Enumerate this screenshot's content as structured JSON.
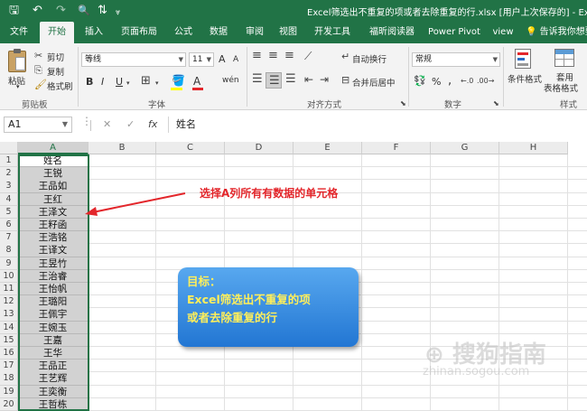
{
  "window": {
    "title": "Excel筛选出不重复的项或者去除重复的行.xlsx [用户上次保存的] - Exc"
  },
  "quick_access": {
    "save": "🖫",
    "undo": "↶",
    "redo": "↷",
    "preview": "🔍",
    "sort": "⇅",
    "more": "⩔"
  },
  "tabs": [
    {
      "label": "文件"
    },
    {
      "label": "开始"
    },
    {
      "label": "插入"
    },
    {
      "label": "页面布局"
    },
    {
      "label": "公式"
    },
    {
      "label": "数据"
    },
    {
      "label": "审阅"
    },
    {
      "label": "视图"
    },
    {
      "label": "开发工具"
    },
    {
      "label": "福昕阅读器"
    },
    {
      "label": "Power Pivot"
    },
    {
      "label": "view"
    },
    {
      "label": "告诉我你想要"
    }
  ],
  "ribbon": {
    "clipboard": {
      "paste": "粘贴",
      "cut": "剪切",
      "copy": "复制",
      "format_painter": "格式刷",
      "group": "剪贴板"
    },
    "font": {
      "name": "等线",
      "size": "11",
      "bold": "B",
      "italic": "I",
      "underline": "U",
      "grow": "A",
      "shrink": "A",
      "wen": "wén",
      "group": "字体"
    },
    "alignment": {
      "wrap": "自动换行",
      "merge": "合并后居中",
      "group": "对齐方式"
    },
    "number": {
      "format": "常规",
      "percent": "%",
      "comma": ",",
      "group": "数字"
    },
    "styles": {
      "conditional": "条件格式",
      "table": "套用",
      "table2": "表格格式",
      "group": "样式"
    }
  },
  "formula_bar": {
    "name_box": "A1",
    "cancel": "✕",
    "enter": "✓",
    "fx": "fx",
    "content": "姓名"
  },
  "sheet": {
    "columns": [
      "A",
      "B",
      "C",
      "D",
      "E",
      "F",
      "G",
      "H"
    ],
    "rows": [
      "1",
      "2",
      "3",
      "4",
      "5",
      "6",
      "7",
      "8",
      "9",
      "10",
      "11",
      "12",
      "13",
      "14",
      "15",
      "16",
      "17",
      "18",
      "19",
      "20"
    ],
    "column_a": [
      "姓名",
      "王锐",
      "王品如",
      "王红",
      "王泽文",
      "王籽函",
      "王浩铭",
      "王译文",
      "王昱竹",
      "王治睿",
      "王怡帆",
      "王璐阳",
      "王佩宇",
      "王婉玉",
      "王嘉",
      "王华",
      "王品正",
      "王艺辉",
      "王奕衡",
      "王哲栋"
    ]
  },
  "annotation": {
    "text": "选择A列所有有数据的单元格"
  },
  "note_box": {
    "line1": "目标：",
    "line2": "Excel筛选出不重复的项",
    "line3": "或者去除重复的行"
  },
  "watermark": {
    "brand": "⊕ 搜狗指南",
    "url": "zhinan.sogou.com"
  },
  "colors": {
    "accent": "#217346",
    "annotation": "#e3262b",
    "note": "#2276d3"
  }
}
